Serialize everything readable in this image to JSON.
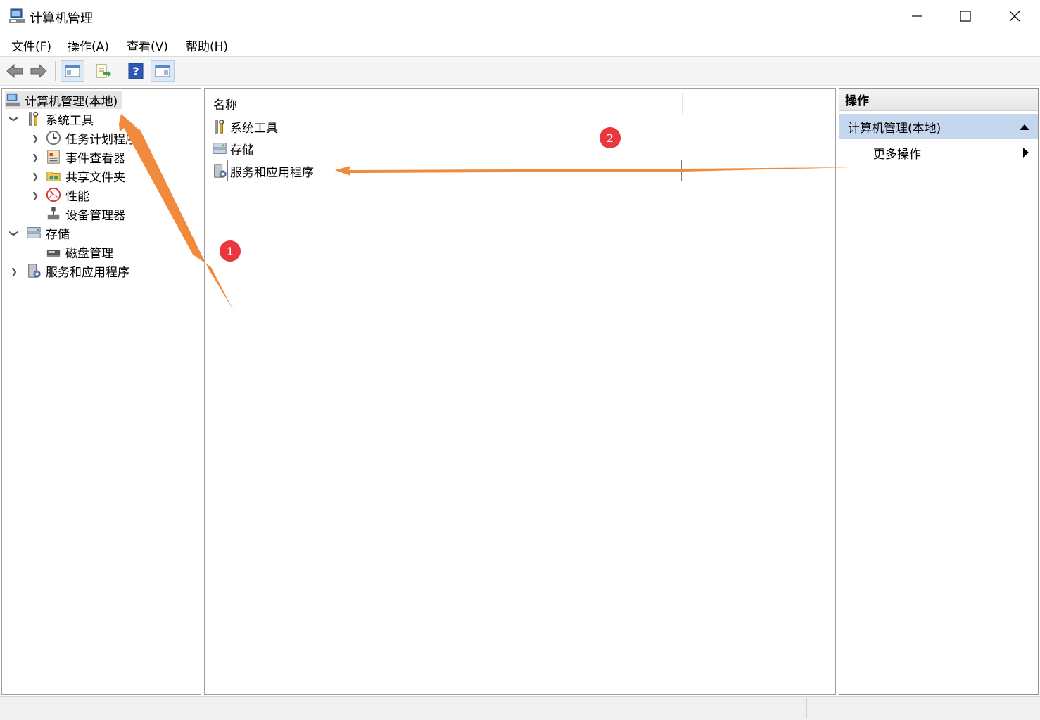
{
  "window": {
    "title": "计算机管理"
  },
  "menu": [
    "文件(F)",
    "操作(A)",
    "查看(V)",
    "帮助(H)"
  ],
  "tree": {
    "root": "计算机管理(本地)",
    "system_tools": "系统工具",
    "task_scheduler": "任务计划程序",
    "event_viewer": "事件查看器",
    "shared_folders": "共享文件夹",
    "performance": "性能",
    "device_manager": "设备管理器",
    "storage": "存储",
    "disk_management": "磁盘管理",
    "services_apps": "服务和应用程序"
  },
  "list": {
    "column_name": "名称",
    "items": [
      "系统工具",
      "存储",
      "服务和应用程序"
    ]
  },
  "actions": {
    "header": "操作",
    "group": "计算机管理(本地)",
    "more": "更多操作"
  },
  "annotations": [
    "1",
    "2"
  ],
  "colors": {
    "arrow": "#f08a3c",
    "badge": "#e8383d",
    "selection": "#c4d7ee"
  }
}
